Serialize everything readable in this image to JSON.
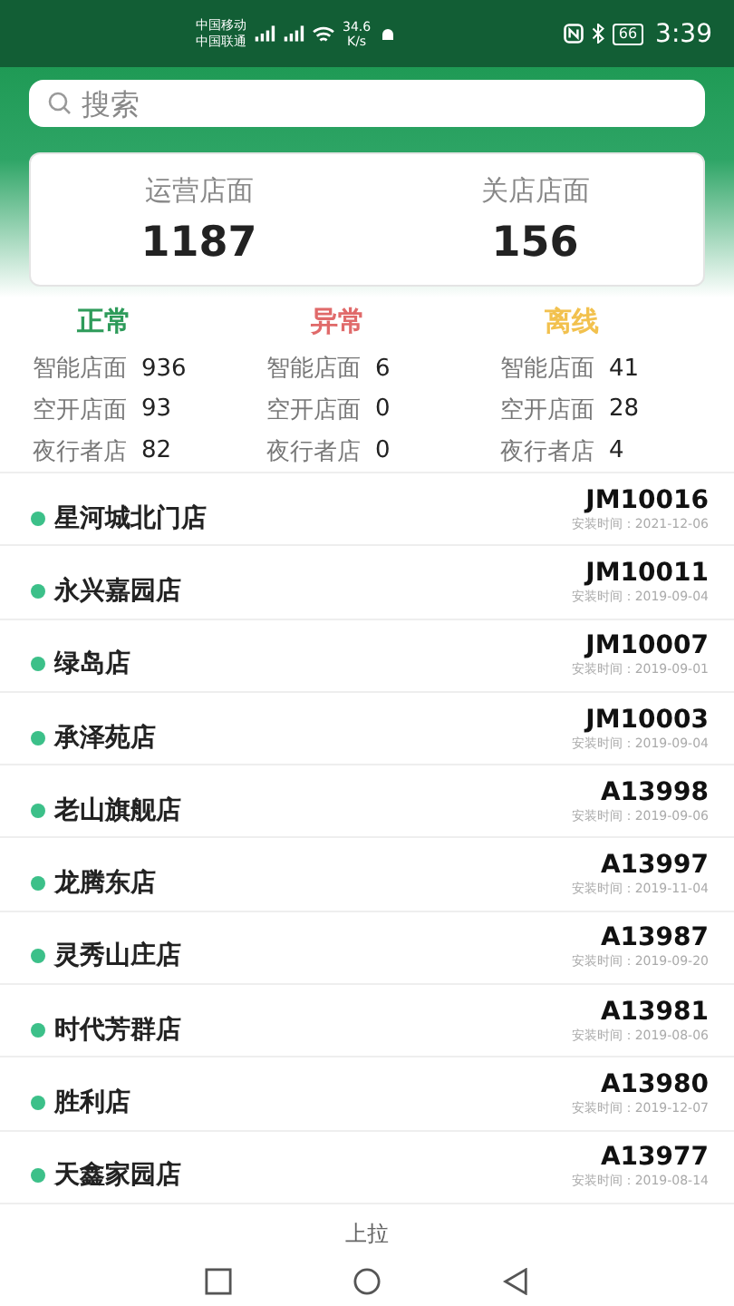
{
  "status_bar": {
    "carriers": [
      "中国移动",
      "中国联通"
    ],
    "net_speed": [
      "34.6",
      "K/s"
    ],
    "battery": "66",
    "time": "3:39"
  },
  "search": {
    "placeholder": "搜索"
  },
  "summary": [
    {
      "label": "运营店面",
      "value": "1187"
    },
    {
      "label": "关店店面",
      "value": "156"
    }
  ],
  "status_groups": [
    {
      "title": "正常",
      "color": "#2e9b5a",
      "rows": [
        {
          "label": "智能店面",
          "value": "936"
        },
        {
          "label": "空开店面",
          "value": "93"
        },
        {
          "label": "夜行者店",
          "value": "82"
        }
      ]
    },
    {
      "title": "异常",
      "color": "#e06a6a",
      "rows": [
        {
          "label": "智能店面",
          "value": "6"
        },
        {
          "label": "空开店面",
          "value": "0"
        },
        {
          "label": "夜行者店",
          "value": "0"
        }
      ]
    },
    {
      "title": "离线",
      "color": "#f2c14e",
      "rows": [
        {
          "label": "智能店面",
          "value": "41"
        },
        {
          "label": "空开店面",
          "value": "28"
        },
        {
          "label": "夜行者店",
          "value": "4"
        }
      ]
    }
  ],
  "stores": [
    {
      "name": "星河城北门店",
      "code": "JM10016",
      "install": "安装时间：2021-12-06"
    },
    {
      "name": "永兴嘉园店",
      "code": "JM10011",
      "install": "安装时间：2019-09-04"
    },
    {
      "name": "绿岛店",
      "code": "JM10007",
      "install": "安装时间：2019-09-01"
    },
    {
      "name": "承泽苑店",
      "code": "JM10003",
      "install": "安装时间：2019-09-04"
    },
    {
      "name": "老山旗舰店",
      "code": "A13998",
      "install": "安装时间：2019-09-06"
    },
    {
      "name": "龙腾东店",
      "code": "A13997",
      "install": "安装时间：2019-11-04"
    },
    {
      "name": "灵秀山庄店",
      "code": "A13987",
      "install": "安装时间：2019-09-20"
    },
    {
      "name": "时代芳群店",
      "code": "A13981",
      "install": "安装时间：2019-08-06"
    },
    {
      "name": "胜利店",
      "code": "A13980",
      "install": "安装时间：2019-12-07"
    },
    {
      "name": "天鑫家园店",
      "code": "A13977",
      "install": "安装时间：2019-08-14"
    }
  ],
  "footer": "上拉"
}
